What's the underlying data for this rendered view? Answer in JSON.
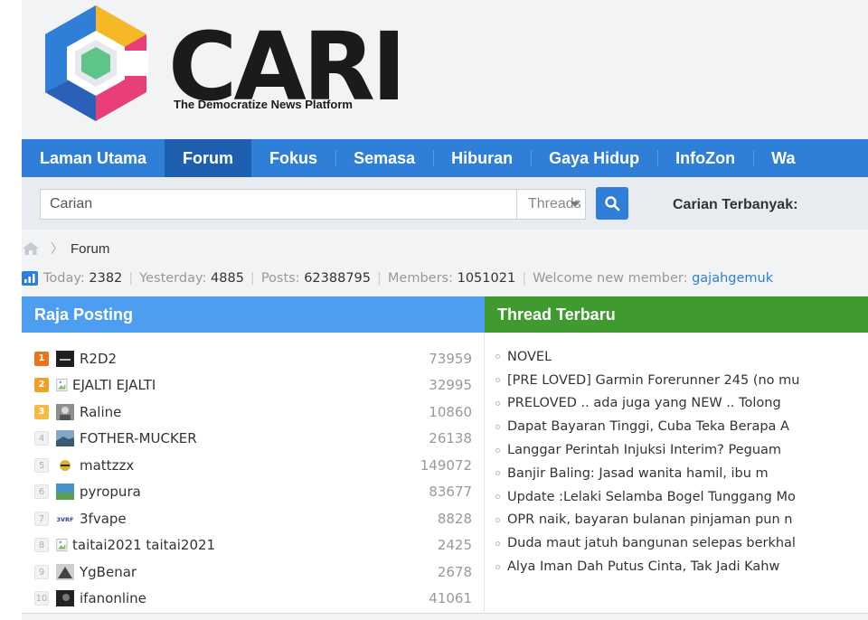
{
  "header": {
    "logo_word": "CARI",
    "tagline": "The Democratize News Platform"
  },
  "nav": [
    {
      "label": "Laman Utama",
      "active": false
    },
    {
      "label": "Forum",
      "active": true
    },
    {
      "label": "Fokus",
      "active": false
    },
    {
      "label": "Semasa",
      "active": false
    },
    {
      "label": "Hiburan",
      "active": false
    },
    {
      "label": "Gaya Hidup",
      "active": false
    },
    {
      "label": "InfoZon",
      "active": false
    },
    {
      "label": "Wa",
      "active": false
    }
  ],
  "search": {
    "placeholder": "Carian",
    "type_value": "Threads",
    "top_label": "Carian Terbanyak:"
  },
  "breadcrumb": {
    "current": "Forum"
  },
  "stats": {
    "today_label": "Today:",
    "today": "2382",
    "yesterday_label": "Yesterday:",
    "yesterday": "4885",
    "posts_label": "Posts:",
    "posts": "62388795",
    "members_label": "Members:",
    "members": "1051021",
    "welcome_label": "Welcome new member:",
    "newest_member": "gajahgemuk"
  },
  "raja_posting": {
    "title": "Raja Posting",
    "rows": [
      {
        "rank": "1",
        "user": "R2D2",
        "count": "73959"
      },
      {
        "rank": "2",
        "user": "EJALTI EJALTI",
        "count": "32995"
      },
      {
        "rank": "3",
        "user": "Raline",
        "count": "10860"
      },
      {
        "rank": "4",
        "user": "FOTHER-MUCKER",
        "count": "26138"
      },
      {
        "rank": "5",
        "user": "mattzzx",
        "count": "149072"
      },
      {
        "rank": "6",
        "user": "pyropura",
        "count": "83677"
      },
      {
        "rank": "7",
        "user": "3fvape",
        "count": "8828",
        "avatar_text": "3VRF"
      },
      {
        "rank": "8",
        "user": "taitai2021 taitai2021",
        "count": "2425"
      },
      {
        "rank": "9",
        "user": "YgBenar",
        "count": "2678"
      },
      {
        "rank": "10",
        "user": "ifanonline",
        "count": "41061"
      }
    ]
  },
  "thread_terbaru": {
    "title": "Thread Terbaru",
    "items": [
      "NOVEL",
      "[PRE LOVED] Garmin Forerunner 245 (no mu",
      "PRELOVED .. ada juga yang NEW .. Tolong",
      "Dapat Bayaran Tinggi, Cuba Teka Berapa A",
      "Langgar Perintah Injuksi Interim? Peguam",
      "Banjir Baling: Jasad wanita hamil, ibu m",
      "Update :Lelaki Selamba Bogel Tunggang Mo",
      "OPR naik, bayaran bulanan pinjaman pun n",
      "Duda maut jatuh bangunan selepas berkhal",
      "Alya Iman Dah Putus Cinta, Tak Jadi Kahw"
    ]
  },
  "colors": {
    "nav": "#2f7ed8",
    "nav_active": "#1f5fb0",
    "raja_head": "#4d9ef0",
    "thread_head": "#3f9a2f",
    "link": "#2f7ed8"
  }
}
